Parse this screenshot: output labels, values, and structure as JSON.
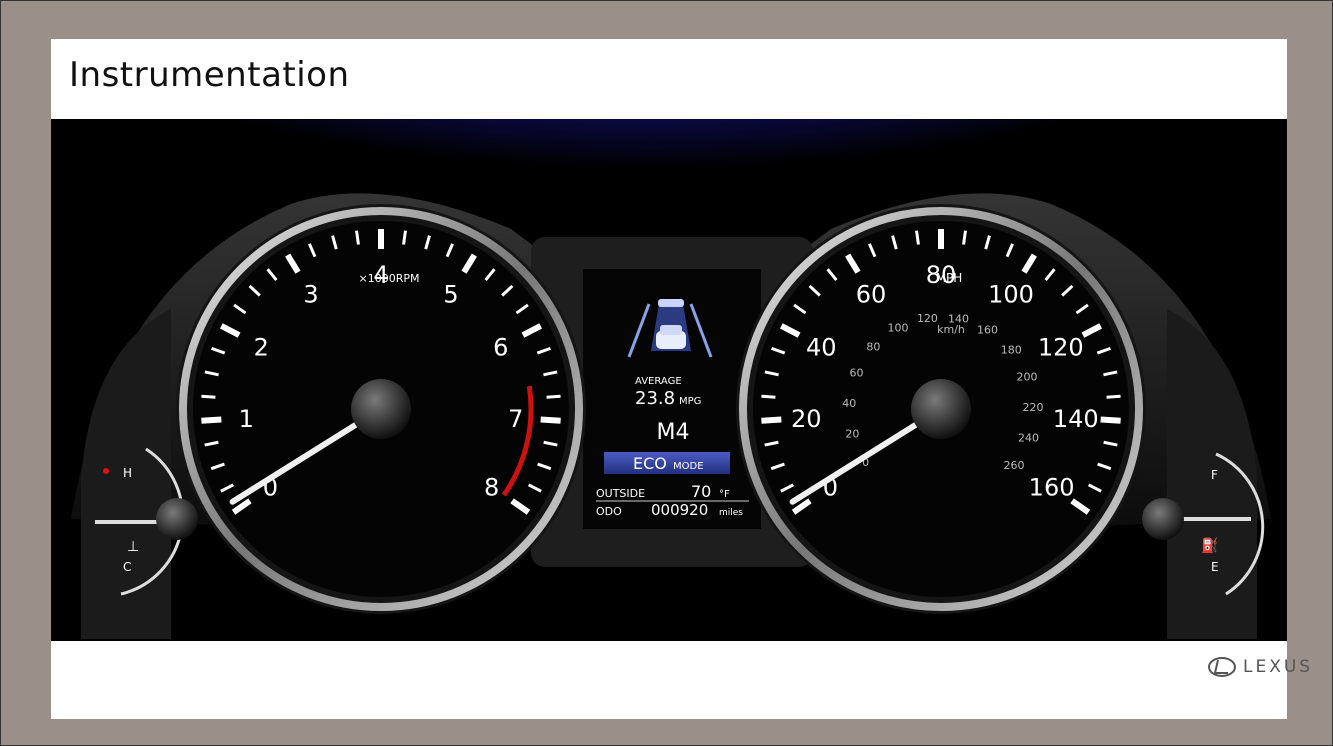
{
  "slide": {
    "title": "Instrumentation"
  },
  "tachometer": {
    "numbers": [
      "0",
      "1",
      "2",
      "3",
      "4",
      "5",
      "6",
      "7",
      "8"
    ],
    "unit_label": "×1000RPM"
  },
  "speedometer": {
    "mph_numbers": [
      "0",
      "20",
      "40",
      "60",
      "80",
      "100",
      "120",
      "140",
      "160"
    ],
    "unit_label": "MPH",
    "kmh_numbers": [
      "0",
      "20",
      "40",
      "60",
      "80",
      "100",
      "120",
      "140",
      "160",
      "180",
      "200",
      "220",
      "240",
      "260"
    ],
    "kmh_label": "km/h"
  },
  "temp_gauge": {
    "high": "H",
    "low": "C"
  },
  "fuel_gauge": {
    "full": "F",
    "empty": "E"
  },
  "info_display": {
    "average_label": "AVERAGE",
    "mpg_value": "23.8",
    "mpg_unit": "MPG",
    "gear": "M4",
    "eco_main": "ECO",
    "eco_sub": "MODE",
    "outside_label": "OUTSIDE",
    "outside_value": "70",
    "outside_unit": "°F",
    "odo_label": "ODO",
    "odo_value": "000920",
    "odo_unit": "miles"
  },
  "brand": {
    "logo_text": "LEXUS"
  },
  "colors": {
    "background": "#9b8f8a",
    "eco_band": "#2c3f9b",
    "redline": "#cc1111",
    "ambient_glow": "#1a1aa0"
  }
}
